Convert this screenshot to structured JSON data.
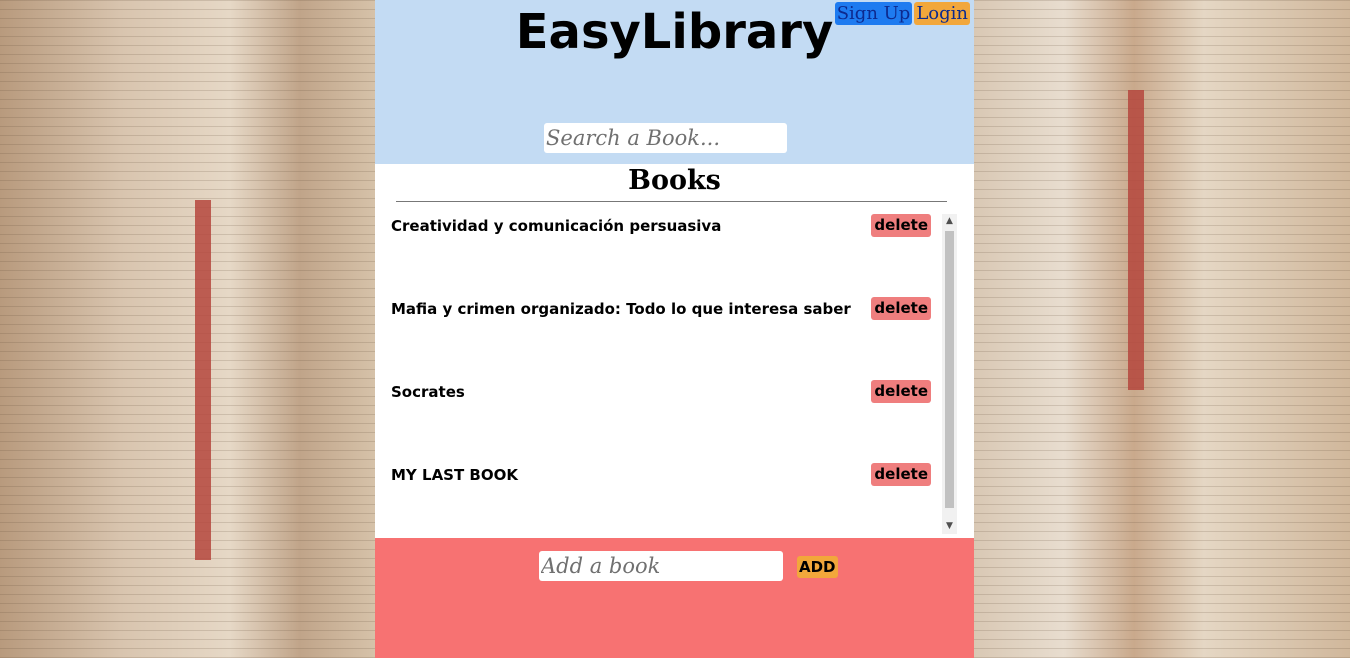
{
  "app": {
    "title": "EasyLibrary"
  },
  "header": {
    "signup_label": "Sign Up",
    "login_label": "Login",
    "search_placeholder": "Search a Book..."
  },
  "books": {
    "heading": "Books",
    "delete_label": "delete",
    "items": [
      {
        "title": "Creatividad y comunicación persuasiva"
      },
      {
        "title": "Mafia y crimen organizado: Todo lo que interesa saber"
      },
      {
        "title": "Socrates"
      },
      {
        "title": "MY LAST BOOK"
      }
    ]
  },
  "footer": {
    "add_placeholder": "Add a book",
    "add_label": "ADD"
  },
  "colors": {
    "header_bg": "#c3dbf3",
    "footer_bg": "#f77272",
    "signup_bg": "#1e7bf0",
    "login_bg": "#f2a73b",
    "delete_bg": "#ef7e7e",
    "add_bg": "#f2a73b"
  },
  "icons": {
    "scroll_up": "triangle-up-icon",
    "scroll_down": "triangle-down-icon"
  }
}
